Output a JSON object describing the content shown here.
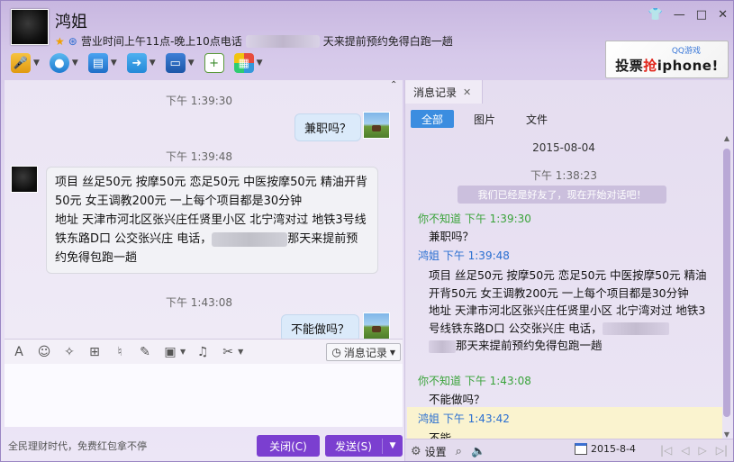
{
  "contact": {
    "name": "鸿姐",
    "status_pre": "营业时间上午11点-晚上10点电话",
    "status_post": "天来提前预约免得白跑一趟"
  },
  "window_controls": {
    "skin": "👕",
    "minimize": "—",
    "maximize": "□",
    "close": "✕"
  },
  "ad": {
    "small": "QQ游戏",
    "main_pre": "投票",
    "main_red": "抢",
    "main_post": "iphone!"
  },
  "chat": {
    "messages": [
      {
        "time": "下午 1:39:30",
        "text": "兼职吗？"
      },
      {
        "time": "下午 1:39:48",
        "line1": "项目 丝足50元 按摩50元 恋足50元 中医按摩50元 精油开背50元 女王调教200元 一上每个项目都是30分钟",
        "line2_pre": "地址 天津市河北区张兴庄任贤里小区 北宁湾对过 地铁3号线铁东路D口 公交张兴庄 电话，",
        "line2_post": "那天来提前预约免得包跑一趟"
      },
      {
        "time": "下午 1:43:08",
        "text": "不能做吗？"
      }
    ]
  },
  "input_toolbar": {
    "history_label": "消息记录"
  },
  "bottom": {
    "ad_text": "全民理财时代，免费红包拿不停",
    "close_label": "关闭(C)",
    "send_label": "发送(S)"
  },
  "history": {
    "tab_label": "消息记录",
    "filters": [
      "全部",
      "图片",
      "文件"
    ],
    "date": "2015-08-04",
    "time1": "下午 1:38:23",
    "system_msg": "我们已经是好友了，现在开始对话吧！",
    "entries": [
      {
        "sender": "你不知道 下午 1:39:30",
        "text": "兼职吗？"
      },
      {
        "sender": "鸿姐 下午 1:39:48",
        "line1": "项目 丝足50元 按摩50元 恋足50元 中医按摩50元 精油开背50元 女王调教200元 一上每个项目都是30分钟",
        "line2": "地址 天津市河北区张兴庄任贤里小区 北宁湾对过 地铁3号线铁东路D口 公交张兴庄 电话，",
        "line3": "那天来提前预约免得包跑一趟"
      },
      {
        "sender": "你不知道 下午 1:43:08",
        "text": "不能做吗？"
      },
      {
        "sender": "鸿姐 下午 1:43:42",
        "text": "不能"
      }
    ],
    "settings_label": "设置",
    "date_box": "2015-8-4"
  }
}
